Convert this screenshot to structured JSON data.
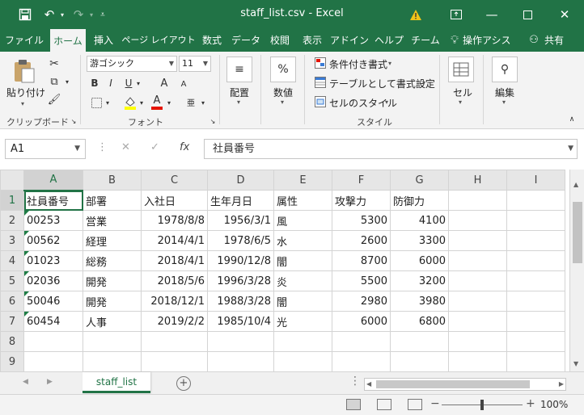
{
  "titlebar": {
    "title": "staff_list.csv  -  Excel",
    "save_icon": "save-icon",
    "undo_icon": "undo-icon",
    "redo_icon": "redo-icon",
    "warning_icon": "warning-icon",
    "brand_color": "#217346"
  },
  "tabs": [
    {
      "label": "ファイル"
    },
    {
      "label": "ホーム"
    },
    {
      "label": "挿入"
    },
    {
      "label": "ページ レイアウト"
    },
    {
      "label": "数式"
    },
    {
      "label": "データ"
    },
    {
      "label": "校閲"
    },
    {
      "label": "表示"
    },
    {
      "label": "アドイン"
    },
    {
      "label": "ヘルプ"
    },
    {
      "label": "チーム"
    },
    {
      "label": "操作アシス"
    },
    {
      "label": "共有"
    }
  ],
  "ribbon": {
    "paste": "貼り付け",
    "clipboard": "クリップボード",
    "font_name": "游ゴシック",
    "font_size": "11",
    "bold": "B",
    "italic": "I",
    "underline": "U",
    "grow": "A",
    "shrink": "A",
    "font_color_letter": "A",
    "font_group": "フォント",
    "align": "配置",
    "number": "数値",
    "percent": "%",
    "cond_format": "条件付き書式",
    "table_format": "テーブルとして書式設定",
    "cell_style": "セルのスタイル",
    "style_group": "スタイル",
    "cells": "セル",
    "edit": "編集"
  },
  "formula_bar": {
    "name_box": "A1",
    "fx": "fx",
    "content": "社員番号"
  },
  "sheet": {
    "columns": [
      "A",
      "B",
      "C",
      "D",
      "E",
      "F",
      "G",
      "H",
      "I"
    ],
    "row_numbers": [
      "1",
      "2",
      "3",
      "4",
      "5",
      "6",
      "7",
      "8",
      "9"
    ],
    "rows": [
      [
        "社員番号",
        "部署",
        "入社日",
        "生年月日",
        "属性",
        "攻撃力",
        "防御力",
        "",
        ""
      ],
      [
        "00253",
        "営業",
        "1978/8/8",
        "1956/3/1",
        "風",
        "5300",
        "4100",
        "",
        ""
      ],
      [
        "00562",
        "経理",
        "2014/4/1",
        "1978/6/5",
        "水",
        "2600",
        "3300",
        "",
        ""
      ],
      [
        "01023",
        "総務",
        "2018/4/1",
        "1990/12/8",
        "闇",
        "8700",
        "6000",
        "",
        ""
      ],
      [
        "02036",
        "開発",
        "2018/5/6",
        "1996/3/28",
        "炎",
        "5500",
        "3200",
        "",
        ""
      ],
      [
        "50046",
        "開発",
        "2018/12/1",
        "1988/3/28",
        "闇",
        "2980",
        "3980",
        "",
        ""
      ],
      [
        "60454",
        "人事",
        "2019/2/2",
        "1985/10/4",
        "光",
        "6000",
        "6800",
        "",
        ""
      ],
      [
        "",
        "",
        "",
        "",
        "",
        "",
        "",
        "",
        ""
      ],
      [
        "",
        "",
        "",
        "",
        "",
        "",
        "",
        "",
        ""
      ]
    ]
  },
  "sheet_tabs": {
    "active": "staff_list",
    "add": "+"
  },
  "statusbar": {
    "zoom": "100%",
    "minus": "−",
    "plus": "+"
  }
}
